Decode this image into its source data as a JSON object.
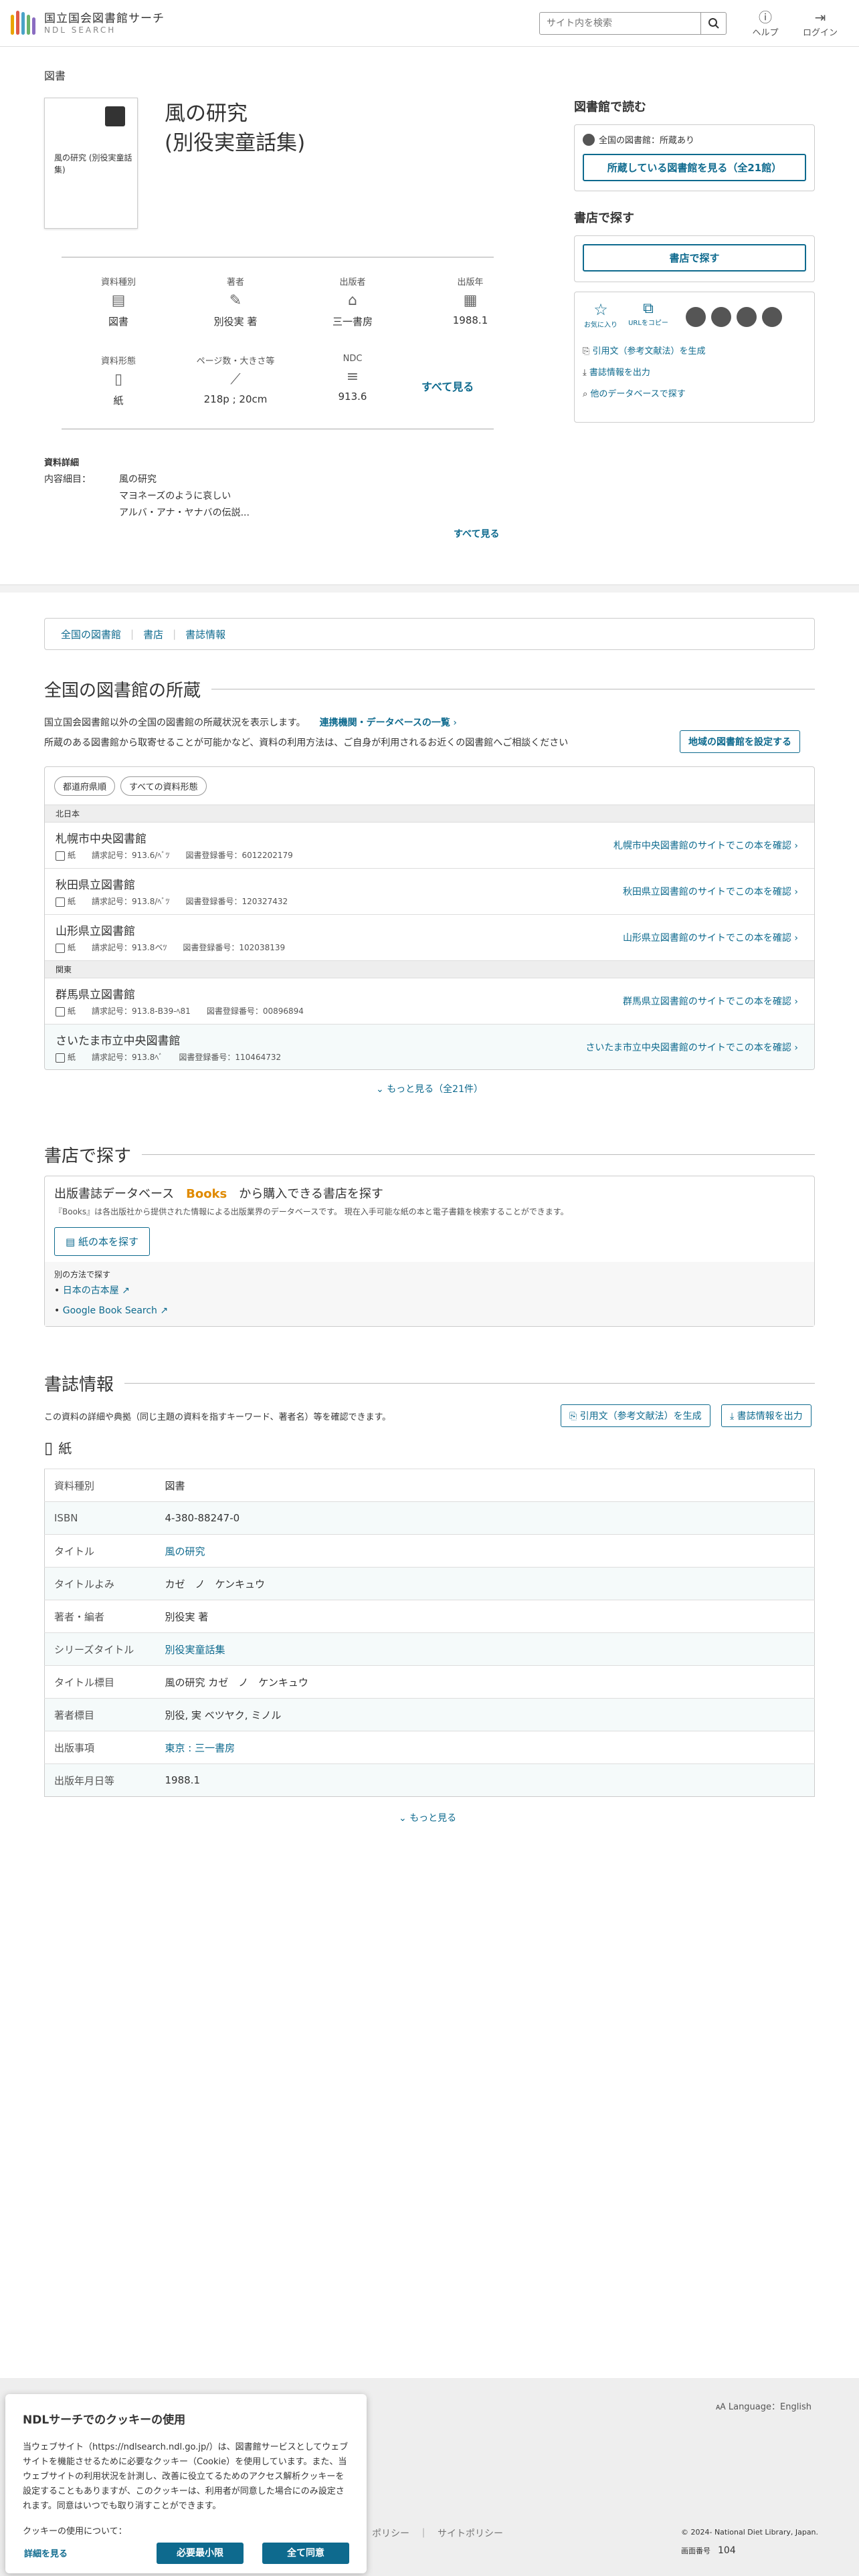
{
  "header": {
    "logo_main": "国立国会図書館サーチ",
    "logo_sub": "NDL SEARCH",
    "search_placeholder": "サイト内を検索",
    "help": "ヘルプ",
    "login": "ログイン"
  },
  "item": {
    "category": "図書",
    "thumb_title": "風の研究 (別役実童話集)",
    "title_line1": "風の研究",
    "title_line2": "(別役実童話集)"
  },
  "props": {
    "row1": [
      {
        "label": "資料種別",
        "value": "図書",
        "icon": "book-icon"
      },
      {
        "label": "著者",
        "value": "別役実 著",
        "icon": "pen-icon"
      },
      {
        "label": "出版者",
        "value": "三一書房",
        "icon": "building-icon"
      },
      {
        "label": "出版年",
        "value": "1988.1",
        "icon": "calendar-icon"
      }
    ],
    "row2": [
      {
        "label": "資料形態",
        "value": "紙",
        "icon": "paper-icon"
      },
      {
        "label": "ページ数・大きさ等",
        "value": "218p ; 20cm",
        "icon": "ruler-icon"
      },
      {
        "label": "NDC",
        "value": "913.6",
        "icon": "list-icon"
      }
    ],
    "see_all": "すべて見る"
  },
  "details": {
    "heading": "資料詳細",
    "contents_label": "内容細目：",
    "contents": [
      "風の研究",
      "マヨネーズのように哀しい",
      "アルバ・アナ・ヤナバの伝説..."
    ],
    "see_all": "すべて見る"
  },
  "side": {
    "read_title": "図書館で読む",
    "holding_status": "全国の図書館：所蔵あり",
    "holding_button": "所蔵している図書館を見る（全21館）",
    "shop_title": "書店で探す",
    "shop_button": "書店で探す",
    "favorite": "お気に入り",
    "urlcopy": "URLをコピー",
    "cite": "引用文（参考文献法）を生成",
    "export": "書誌情報を出力",
    "otherdb": "他のデータベースで探す"
  },
  "tabs": [
    "全国の図書館",
    "書店",
    "書誌情報"
  ],
  "libs": {
    "heading": "全国の図書館の所蔵",
    "desc1": "国立国会図書館以外の全国の図書館の所蔵状況を表示します。",
    "link1": "連携機関・データベースの一覧",
    "desc2": "所蔵のある図書館から取寄せることが可能かなど、資料の利用方法は、ご自身が利用されるお近くの図書館へご相談ください",
    "region_button": "地域の図書館を設定する",
    "filter1": "都道府県順",
    "filter2": "すべての資料形態",
    "region1": "北日本",
    "region2": "関東",
    "type_label": "紙",
    "rows": [
      {
        "name": "札幌市中央図書館",
        "call": "請求記号：913.6/ﾍﾞﾂ",
        "reg": "図書登録番号：6012202179",
        "link": "札幌市中央図書館のサイトでこの本を確認"
      },
      {
        "name": "秋田県立図書館",
        "call": "請求記号：913.8/ﾍﾞﾂ",
        "reg": "図書登録番号：120327432",
        "link": "秋田県立図書館のサイトでこの本を確認"
      },
      {
        "name": "山形県立図書館",
        "call": "請求記号：913.8ベﾂ",
        "reg": "図書登録番号：102038139",
        "link": "山形県立図書館のサイトでこの本を確認"
      },
      {
        "name": "群馬県立図書館",
        "call": "請求記号：913.8-B39-ﾍ81",
        "reg": "図書登録番号：00896894",
        "link": "群馬県立図書館のサイトでこの本を確認"
      },
      {
        "name": "さいたま市立中央図書館",
        "call": "請求記号：913.8ﾍﾞ",
        "reg": "図書登録番号：110464732",
        "link": "さいたま市立中央図書館のサイトでこの本を確認"
      }
    ],
    "more": "もっと見る（全21件）"
  },
  "shop": {
    "heading": "書店で探す",
    "db_prefix": "出版書誌データベース",
    "db_name": "Books",
    "db_suffix": "から購入できる書店を探す",
    "db_desc": "『Books』は各出版社から提供された情報による出版業界のデータベースです。 現在入手可能な紙の本と電子書籍を検索することができます。",
    "paper_button": "紙の本を探す",
    "other_label": "別の方法で探す",
    "links": [
      "日本の古本屋",
      "Google Book Search"
    ]
  },
  "biblio": {
    "heading": "書誌情報",
    "desc": "この資料の詳細や典拠（同じ主題の資料を指すキーワード、著者名）等を確認できます。",
    "cite_button": "引用文（参考文献法）を生成",
    "export_button": "書誌情報を出力",
    "form": "紙",
    "rows": [
      {
        "k": "資料種別",
        "v": "図書"
      },
      {
        "k": "ISBN",
        "v": "4-380-88247-0"
      },
      {
        "k": "タイトル",
        "v": "風の研究",
        "link": true
      },
      {
        "k": "タイトルよみ",
        "v": "カゼ　ノ　ケンキュウ"
      },
      {
        "k": "著者・編者",
        "v": "別役実 著"
      },
      {
        "k": "シリーズタイトル",
        "v": "別役実童話集",
        "link": true
      },
      {
        "k": "タイトル標目",
        "v": "風の研究 カゼ　ノ　ケンキュウ"
      },
      {
        "k": "著者標目",
        "v": "別役, 実 ベツヤク, ミノル"
      },
      {
        "k": "出版事項",
        "v": "東京 : 三一書房",
        "link": true
      },
      {
        "k": "出版年月日等",
        "v": "1988.1"
      }
    ],
    "more": "もっと見る"
  },
  "footer": {
    "language": "Language：English",
    "links": [
      "ポリシー",
      "サイトポリシー"
    ],
    "copyright": "© 2024- National Diet Library, Japan.",
    "screen_no_label": "画面番号",
    "screen_no": "104"
  },
  "cookie": {
    "title": "NDLサーチでのクッキーの使用",
    "body": "当ウェブサイト（https://ndlsearch.ndl.go.jp/）は、図書館サービスとしてウェブサイトを機能させるために必要なクッキー（Cookie）を使用しています。また、当ウェブサイトの利用状況を計測し、改善に役立てるためのアクセス解析クッキーを設定することもありますが、このクッキーは、利用者が同意した場合にのみ設定されます。同意はいつでも取り消すことができます。",
    "about": "クッキーの使用について：",
    "details": "詳細を見る",
    "minimum": "必要最小限",
    "accept": "全て同意"
  }
}
